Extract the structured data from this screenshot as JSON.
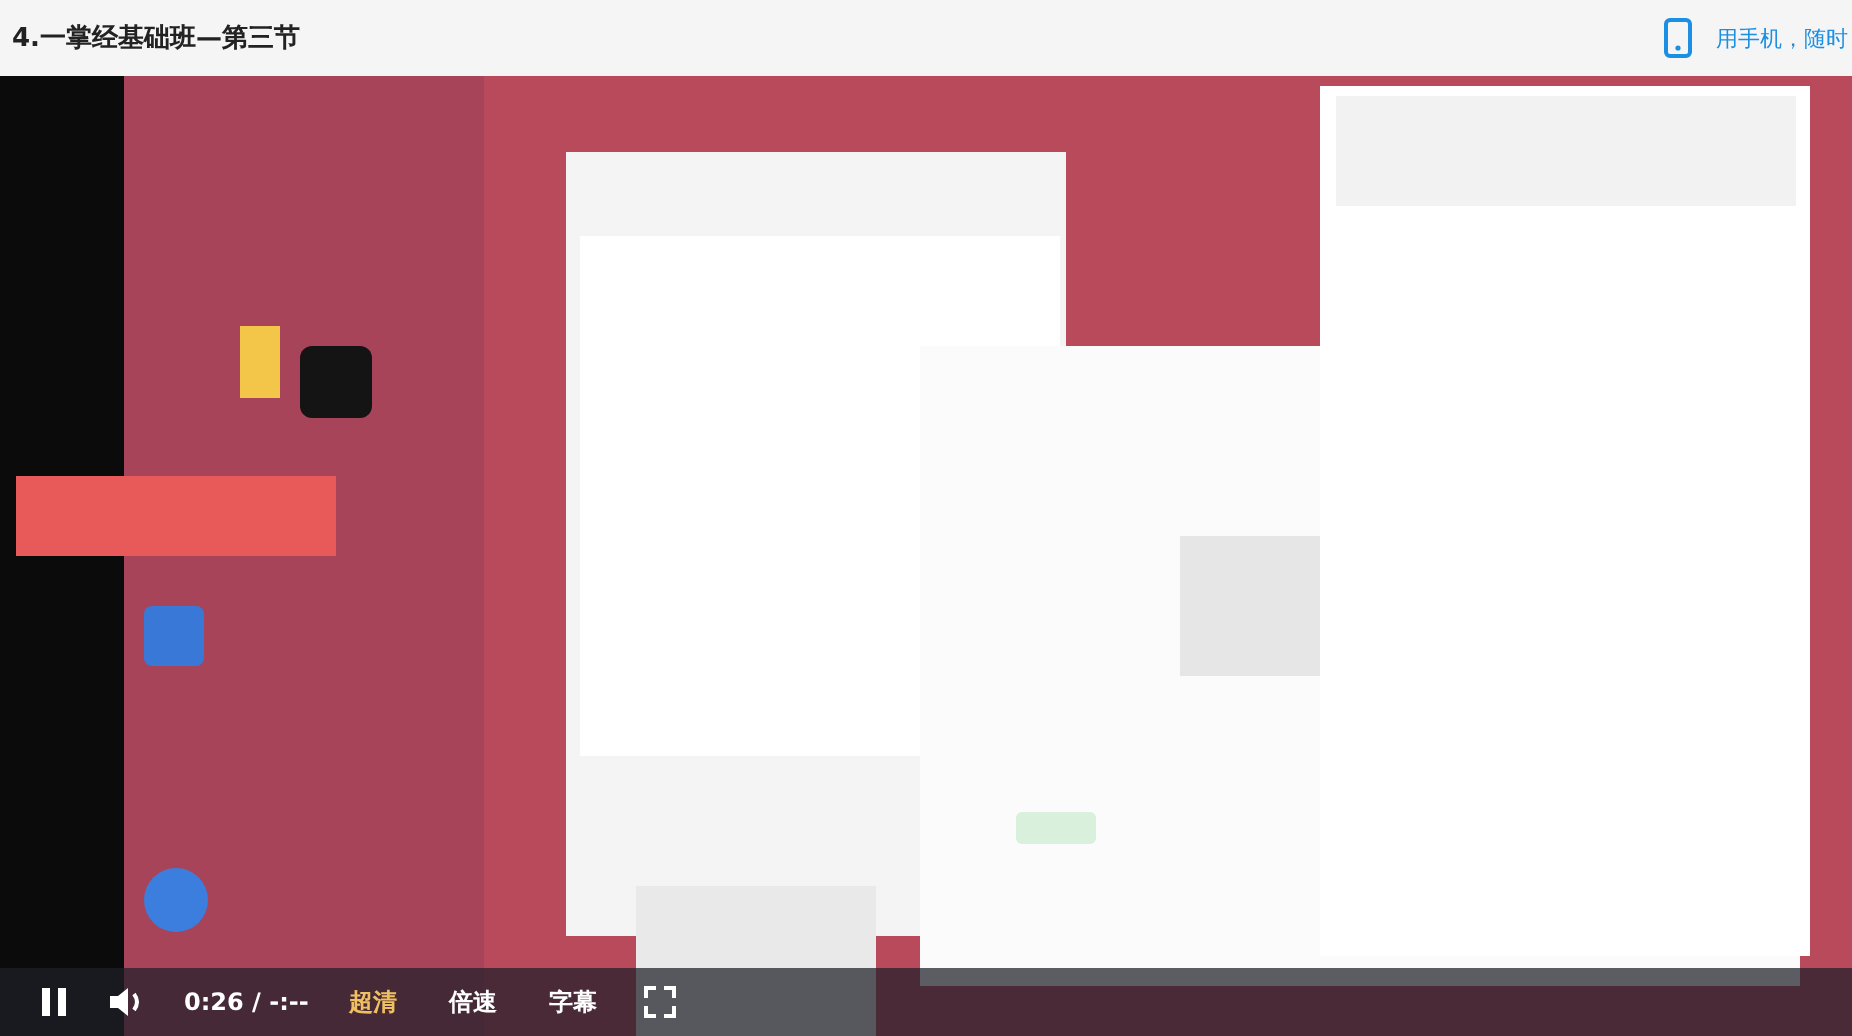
{
  "page": {
    "title": "4.一掌经基础班—第三节",
    "mobile_link": "用手机，随时"
  },
  "player": {
    "playing": true,
    "time": "0:26 / -:--",
    "quality": "超清",
    "speed": "倍速",
    "subtitles": "字幕"
  }
}
